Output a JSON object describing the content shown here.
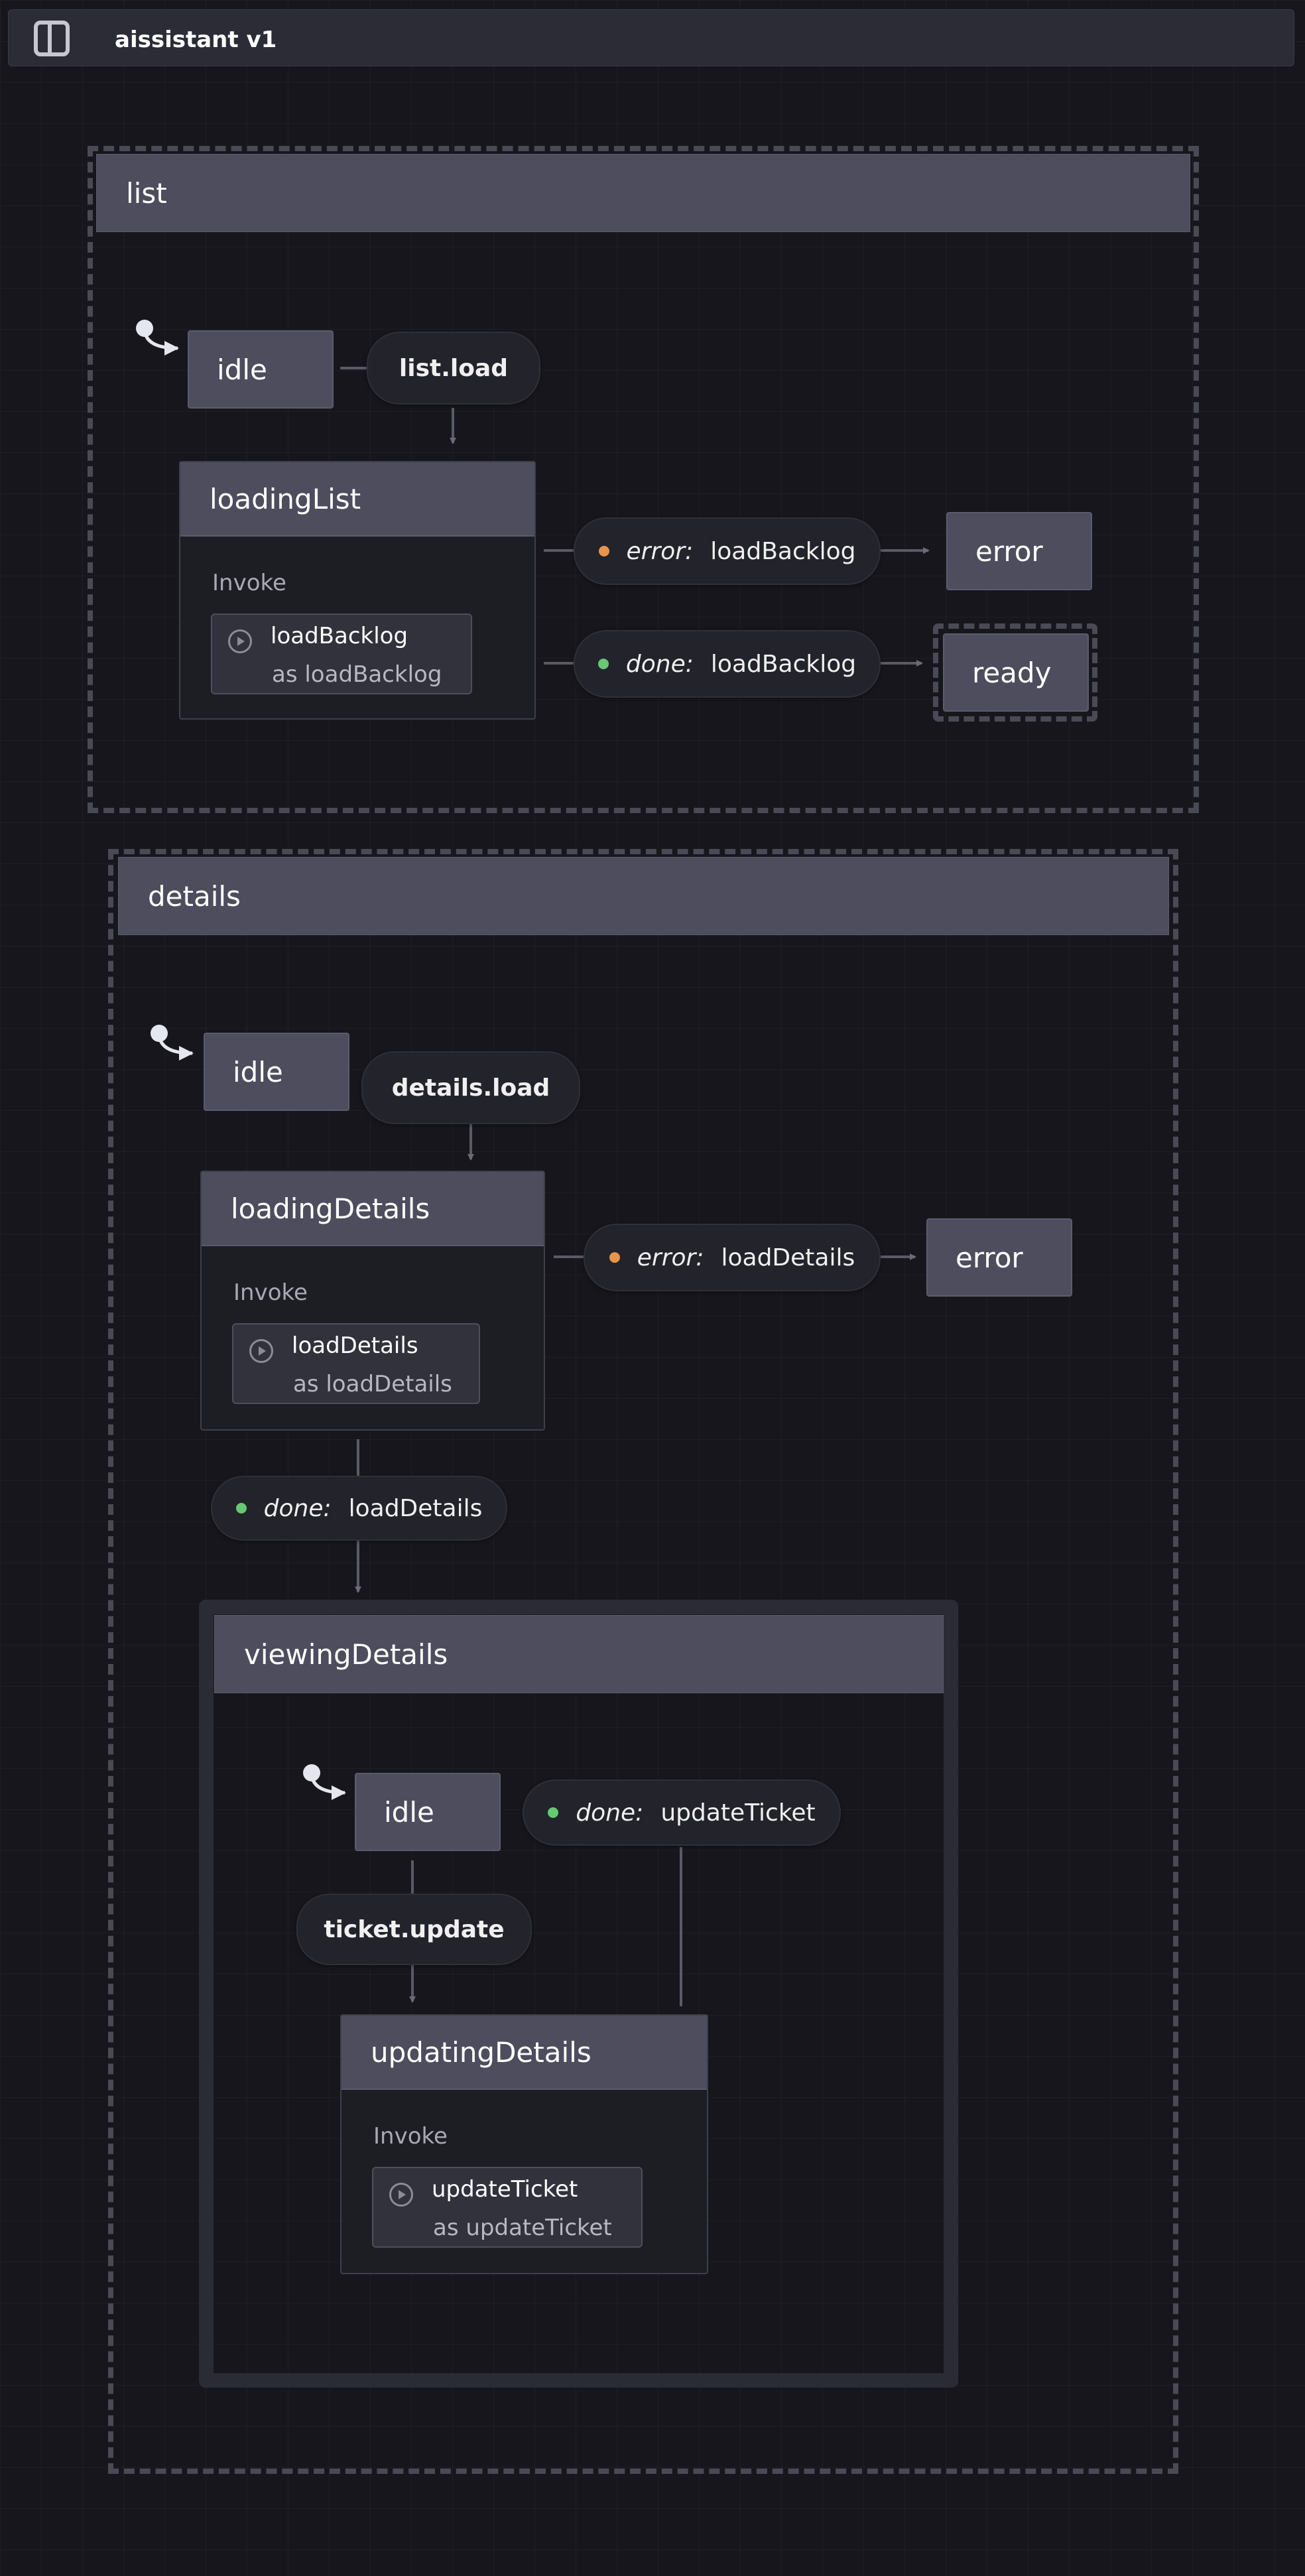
{
  "app": {
    "title": "aissistant v1",
    "panel_icon": "panel-toggle-icon"
  },
  "colors": {
    "error_dot": "#e8944a",
    "done_dot": "#66c872"
  },
  "list": {
    "title": "list",
    "idle": "idle",
    "event": "list.load",
    "loading": "loadingList",
    "invoke_label": "Invoke",
    "actor": {
      "name": "loadBacklog",
      "alias": "as loadBacklog"
    },
    "error_edge": {
      "kind": "error:",
      "name": "loadBacklog"
    },
    "done_edge": {
      "kind": "done:",
      "name": "loadBacklog"
    },
    "error_state": "error",
    "ready_state": "ready"
  },
  "details": {
    "title": "details",
    "idle": "idle",
    "event": "details.load",
    "loading": "loadingDetails",
    "invoke_label": "Invoke",
    "actor": {
      "name": "loadDetails",
      "alias": "as loadDetails"
    },
    "error_edge": {
      "kind": "error:",
      "name": "loadDetails"
    },
    "error_state": "error",
    "done_edge": {
      "kind": "done:",
      "name": "loadDetails"
    },
    "viewing": {
      "title": "viewingDetails",
      "idle": "idle",
      "done_edge": {
        "kind": "done:",
        "name": "updateTicket"
      },
      "event": "ticket.update",
      "updating": "updatingDetails",
      "invoke_label": "Invoke",
      "actor": {
        "name": "updateTicket",
        "alias": "as updateTicket"
      }
    }
  }
}
